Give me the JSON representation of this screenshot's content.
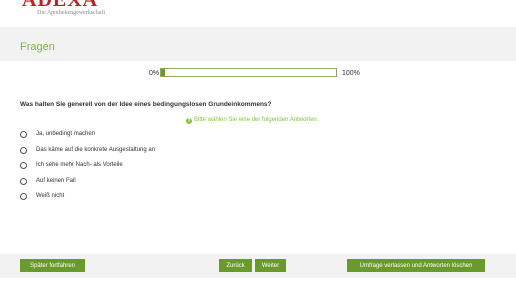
{
  "logo": {
    "name": "ADEXA",
    "tagline": "Die Apothekengewerkschaft"
  },
  "page": {
    "title": "Fragen"
  },
  "progress": {
    "start_label": "0%",
    "end_label": "100%",
    "value_percent": 2
  },
  "question": {
    "text": "Was halten Sie generell von der Idee eines bedingungslosen Grundeinkommens?",
    "hint": "Bitte wählen Sie eine der folgenden Antworten:",
    "hint_icon": "question-circle-icon",
    "options": [
      {
        "label": "Ja, unbedingt machen",
        "selected": false
      },
      {
        "label": "Das käme auf die konkrete Ausgestaltung an",
        "selected": false
      },
      {
        "label": "Ich sehe mehr Nach- als Vorteile",
        "selected": false
      },
      {
        "label": "Auf keinen Fall",
        "selected": false
      },
      {
        "label": "Weiß nicht",
        "selected": false
      }
    ]
  },
  "footer": {
    "later_label": "Später fortfahren",
    "back_label": "Zurück",
    "next_label": "Weiter",
    "leave_label": "Umfrage verlassen und Antworten löschen"
  },
  "colors": {
    "accent": "#6a9a2c",
    "title": "#7cb342",
    "hint": "#8bbf3a",
    "logo": "#c41e1e",
    "band": "#f2f2f2"
  }
}
